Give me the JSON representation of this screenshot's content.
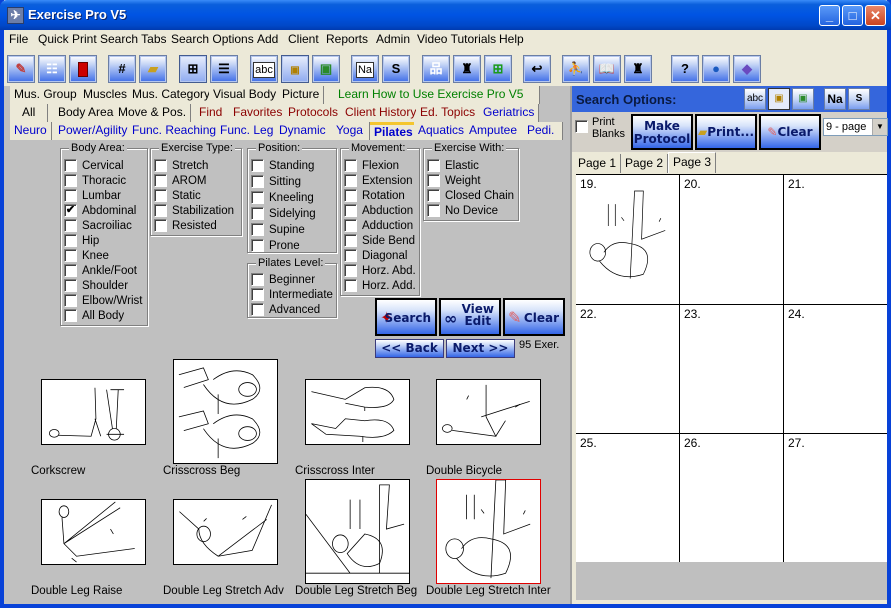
{
  "window": {
    "title": "Exercise Pro V5",
    "controls": [
      "minimize",
      "maximize",
      "close"
    ]
  },
  "menubar": [
    "File",
    "Quick Print",
    "Search Tabs",
    "Search Options",
    "Add",
    "Client",
    "Reports",
    "Admin",
    "Video Tutorials",
    "Help"
  ],
  "toolbar": [
    {
      "icon": "eraser-icon"
    },
    {
      "icon": "list-icon"
    },
    {
      "icon": "exit-door-icon"
    },
    {
      "icon": "number-icon",
      "glyph": "#"
    },
    {
      "icon": "chart-folder-icon"
    },
    {
      "icon": "grid-view-icon",
      "glyph": "⊞",
      "pressed": true
    },
    {
      "icon": "list-view-icon",
      "glyph": "☰"
    },
    {
      "icon": "text-only-icon",
      "glyph": "abc"
    },
    {
      "icon": "picture-text-icon",
      "pressed": true
    },
    {
      "icon": "picture-icon"
    },
    {
      "icon": "name-icon",
      "glyph": "Na"
    },
    {
      "icon": "salt-shaker-icon",
      "glyph": "S"
    },
    {
      "icon": "hierarchy-icon"
    },
    {
      "icon": "weightlifter-icon"
    },
    {
      "icon": "add-exercise-icon"
    },
    {
      "icon": "exercise-return-icon"
    },
    {
      "icon": "runner-document-icon"
    },
    {
      "icon": "book-icon"
    },
    {
      "icon": "weightlifter-document-icon"
    },
    {
      "icon": "help-icon",
      "glyph": "?"
    },
    {
      "icon": "globe-icon"
    },
    {
      "icon": "manual-icon"
    }
  ],
  "tabs": {
    "row1": [
      {
        "label": "Mus. Group",
        "color": "black"
      },
      {
        "label": "Muscles",
        "color": "black"
      },
      {
        "label": "Mus. Category",
        "color": "black"
      },
      {
        "label": "Visual Body",
        "color": "black"
      },
      {
        "label": "Picture",
        "color": "black"
      },
      {
        "label": "Learn How to Use Exercise Pro V5",
        "color": "green"
      }
    ],
    "row2": [
      {
        "label": "All",
        "color": "black"
      },
      {
        "label": "Body Area",
        "color": "black"
      },
      {
        "label": "Move & Pos.",
        "color": "black"
      },
      {
        "label": "Find",
        "color": "red"
      },
      {
        "label": "Favorites",
        "color": "red"
      },
      {
        "label": "Protocols",
        "color": "red"
      },
      {
        "label": "Client History",
        "color": "red"
      },
      {
        "label": "Ed. Topics",
        "color": "red"
      },
      {
        "label": "Geriatrics",
        "color": "blue"
      }
    ],
    "row3": [
      {
        "label": "Neuro",
        "color": "blue"
      },
      {
        "label": "Power/Agility",
        "color": "blue"
      },
      {
        "label": "Func. Reaching",
        "color": "blue"
      },
      {
        "label": "Func. Leg",
        "color": "blue"
      },
      {
        "label": "Dynamic",
        "color": "blue"
      },
      {
        "label": "Yoga",
        "color": "blue"
      },
      {
        "label": "Pilates",
        "color": "blue",
        "active": true
      },
      {
        "label": "Aquatics",
        "color": "blue"
      },
      {
        "label": "Amputee",
        "color": "blue"
      },
      {
        "label": "Pedi.",
        "color": "blue"
      }
    ]
  },
  "filters": {
    "body_area": {
      "title": "Body Area:",
      "items": [
        {
          "label": "Cervical",
          "checked": false
        },
        {
          "label": "Thoracic",
          "checked": false
        },
        {
          "label": "Lumbar",
          "checked": false
        },
        {
          "label": "Abdominal",
          "checked": true
        },
        {
          "label": "Sacroiliac",
          "checked": false
        },
        {
          "label": "Hip",
          "checked": false
        },
        {
          "label": "Knee",
          "checked": false
        },
        {
          "label": "Ankle/Foot",
          "checked": false
        },
        {
          "label": "Shoulder",
          "checked": false
        },
        {
          "label": "Elbow/Wrist",
          "checked": false
        },
        {
          "label": "All Body",
          "checked": false
        }
      ]
    },
    "exercise_type": {
      "title": "Exercise Type:",
      "items": [
        {
          "label": "Stretch",
          "checked": false
        },
        {
          "label": "AROM",
          "checked": false
        },
        {
          "label": "Static",
          "checked": false
        },
        {
          "label": "Stabilization",
          "checked": false
        },
        {
          "label": "Resisted",
          "checked": false
        }
      ]
    },
    "position": {
      "title": "Position:",
      "items": [
        {
          "label": "Standing",
          "checked": false
        },
        {
          "label": "Sitting",
          "checked": false
        },
        {
          "label": "Kneeling",
          "checked": false
        },
        {
          "label": "Sidelying",
          "checked": false
        },
        {
          "label": "Supine",
          "checked": false
        },
        {
          "label": "Prone",
          "checked": false
        }
      ]
    },
    "pilates_level": {
      "title": "Pilates Level:",
      "items": [
        {
          "label": "Beginner",
          "checked": false
        },
        {
          "label": "Intermediate",
          "checked": false
        },
        {
          "label": "Advanced",
          "checked": false
        }
      ]
    },
    "movement": {
      "title": "Movement:",
      "items": [
        {
          "label": "Flexion",
          "checked": false
        },
        {
          "label": "Extension",
          "checked": false
        },
        {
          "label": "Rotation",
          "checked": false
        },
        {
          "label": "Abduction",
          "checked": false
        },
        {
          "label": "Adduction",
          "checked": false
        },
        {
          "label": "Side Bend",
          "checked": false
        },
        {
          "label": "Diagonal",
          "checked": false
        },
        {
          "label": "Horz. Abd.",
          "checked": false
        },
        {
          "label": "Horz. Add.",
          "checked": false
        }
      ]
    },
    "exercise_with": {
      "title": "Exercise With:",
      "items": [
        {
          "label": "Elastic",
          "checked": false
        },
        {
          "label": "Weight",
          "checked": false
        },
        {
          "label": "Closed Chain",
          "checked": false
        },
        {
          "label": "No Device",
          "checked": false
        }
      ]
    }
  },
  "actions": {
    "search": "Search",
    "view_edit_line1": "View",
    "view_edit_line2": "Edit",
    "clear": "Clear",
    "back": "<< Back",
    "next": "Next >>",
    "count": "95 Exer."
  },
  "exercises": [
    {
      "name": "Corkscrew",
      "selected": false
    },
    {
      "name": "Crisscross Beg",
      "selected": false
    },
    {
      "name": "Crisscross Inter",
      "selected": false
    },
    {
      "name": "Double Bicycle",
      "selected": false
    },
    {
      "name": "Double Leg Raise",
      "selected": false
    },
    {
      "name": "Double Leg Stretch Adv",
      "selected": false
    },
    {
      "name": "Double Leg Stretch Beg",
      "selected": false
    },
    {
      "name": "Double Leg Stretch Inter",
      "selected": true
    }
  ],
  "search_options": {
    "title": "Search Options:",
    "view_buttons": [
      {
        "icon": "text-only-icon",
        "glyph": "abc"
      },
      {
        "icon": "picture-text-icon",
        "pressed": true
      },
      {
        "icon": "picture-icon"
      },
      {
        "icon": "name-icon",
        "glyph": "Na"
      },
      {
        "icon": "salt-shaker-icon",
        "glyph": "S"
      }
    ],
    "print_blanks_line1": "Print",
    "print_blanks_line2": "Blanks",
    "print_blanks_checked": false,
    "make_protocol_line1": "Make",
    "make_protocol_line2": "Protocol",
    "print": "Print...",
    "clear": "Clear",
    "layout_select": "9 - page",
    "page_tabs": [
      {
        "label": "Page 1",
        "active": false
      },
      {
        "label": "Page 2",
        "active": false
      },
      {
        "label": "Page 3",
        "active": true
      }
    ],
    "slots": [
      {
        "num": "19.",
        "exercise": "Double Leg Stretch Inter"
      },
      {
        "num": "20.",
        "exercise": ""
      },
      {
        "num": "21.",
        "exercise": ""
      },
      {
        "num": "22.",
        "exercise": ""
      },
      {
        "num": "23.",
        "exercise": ""
      },
      {
        "num": "24.",
        "exercise": ""
      },
      {
        "num": "25.",
        "exercise": ""
      },
      {
        "num": "26.",
        "exercise": ""
      },
      {
        "num": "27.",
        "exercise": ""
      }
    ]
  }
}
